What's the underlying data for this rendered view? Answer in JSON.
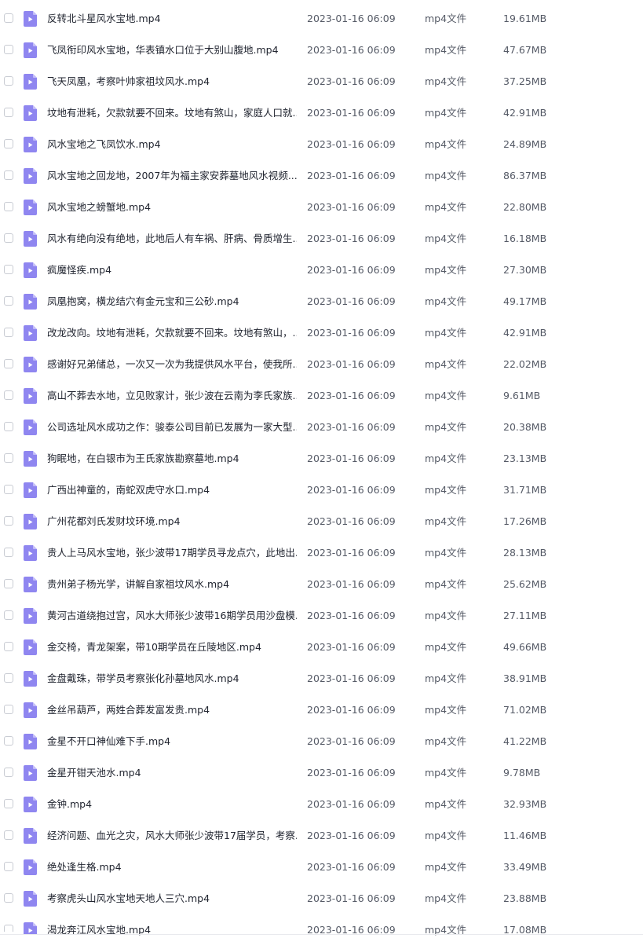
{
  "icons": {
    "file": "video-file-icon",
    "checkbox": "checkbox-unchecked",
    "icon_color": "#8f86f0",
    "icon_fold_color": "#c3bdf8"
  },
  "files": [
    {
      "name": "反转北斗星风水宝地.mp4",
      "date": "2023-01-16 06:09",
      "type": "mp4文件",
      "size": "19.61MB"
    },
    {
      "name": "飞凤衔印风水宝地，华表镇水口位于大别山腹地.mp4",
      "date": "2023-01-16 06:09",
      "type": "mp4文件",
      "size": "47.67MB"
    },
    {
      "name": "飞天凤凰，考察叶帅家祖坟风水.mp4",
      "date": "2023-01-16 06:09",
      "type": "mp4文件",
      "size": "37.25MB"
    },
    {
      "name": "坟地有泄耗，欠款就要不回来。坟地有煞山，家庭人口就...",
      "date": "2023-01-16 06:09",
      "type": "mp4文件",
      "size": "42.91MB"
    },
    {
      "name": "风水宝地之飞凤饮水.mp4",
      "date": "2023-01-16 06:09",
      "type": "mp4文件",
      "size": "24.89MB"
    },
    {
      "name": "风水宝地之回龙地，2007年为福主家安葬墓地风水视频....",
      "date": "2023-01-16 06:09",
      "type": "mp4文件",
      "size": "86.37MB"
    },
    {
      "name": "风水宝地之螃蟹地.mp4",
      "date": "2023-01-16 06:09",
      "type": "mp4文件",
      "size": "22.80MB"
    },
    {
      "name": "风水有绝向没有绝地，此地后人有车祸、肝病、骨质增生...",
      "date": "2023-01-16 06:09",
      "type": "mp4文件",
      "size": "16.18MB"
    },
    {
      "name": "疯魔怪疾.mp4",
      "date": "2023-01-16 06:09",
      "type": "mp4文件",
      "size": "27.30MB"
    },
    {
      "name": "凤凰抱窝，横龙结穴有金元宝和三公砂.mp4",
      "date": "2023-01-16 06:09",
      "type": "mp4文件",
      "size": "49.17MB"
    },
    {
      "name": "改龙改向。坟地有泄耗，欠款就要不回来。坟地有煞山，...",
      "date": "2023-01-16 06:09",
      "type": "mp4文件",
      "size": "42.91MB"
    },
    {
      "name": "感谢好兄弟储总，一次又一次为我提供风水平台，使我所...",
      "date": "2023-01-16 06:09",
      "type": "mp4文件",
      "size": "22.02MB"
    },
    {
      "name": "高山不葬去水地，立见败家计，张少波在云南为李氏家族...",
      "date": "2023-01-16 06:09",
      "type": "mp4文件",
      "size": "9.61MB"
    },
    {
      "name": "公司选址风水成功之作：骏泰公司目前已发展为一家大型...",
      "date": "2023-01-16 06:09",
      "type": "mp4文件",
      "size": "20.38MB"
    },
    {
      "name": "狗眠地，在白银市为王氏家族勘察墓地.mp4",
      "date": "2023-01-16 06:09",
      "type": "mp4文件",
      "size": "23.13MB"
    },
    {
      "name": "广西出神童的，南蛇双虎守水口.mp4",
      "date": "2023-01-16 06:09",
      "type": "mp4文件",
      "size": "31.71MB"
    },
    {
      "name": "广州花都刘氏发财坟环境.mp4",
      "date": "2023-01-16 06:09",
      "type": "mp4文件",
      "size": "17.26MB"
    },
    {
      "name": "贵人上马风水宝地，张少波带17期学员寻龙点穴，此地出...",
      "date": "2023-01-16 06:09",
      "type": "mp4文件",
      "size": "28.13MB"
    },
    {
      "name": "贵州弟子杨光学，讲解自家祖坟风水.mp4",
      "date": "2023-01-16 06:09",
      "type": "mp4文件",
      "size": "25.62MB"
    },
    {
      "name": "黄河古道绕抱过宫，风水大师张少波带16期学员用沙盘模...",
      "date": "2023-01-16 06:09",
      "type": "mp4文件",
      "size": "27.11MB"
    },
    {
      "name": "金交椅，青龙架案，带10期学员在丘陵地区.mp4",
      "date": "2023-01-16 06:09",
      "type": "mp4文件",
      "size": "49.66MB"
    },
    {
      "name": "金盘戴珠，带学员考察张化孙墓地风水.mp4",
      "date": "2023-01-16 06:09",
      "type": "mp4文件",
      "size": "38.91MB"
    },
    {
      "name": "金丝吊葫芦，两姓合葬发富发贵.mp4",
      "date": "2023-01-16 06:09",
      "type": "mp4文件",
      "size": "71.02MB"
    },
    {
      "name": "金星不开口神仙难下手.mp4",
      "date": "2023-01-16 06:09",
      "type": "mp4文件",
      "size": "41.22MB"
    },
    {
      "name": "金星开钳天池水.mp4",
      "date": "2023-01-16 06:09",
      "type": "mp4文件",
      "size": "9.78MB"
    },
    {
      "name": "金钟.mp4",
      "date": "2023-01-16 06:09",
      "type": "mp4文件",
      "size": "32.93MB"
    },
    {
      "name": "经济问题、血光之灾，风水大师张少波带17届学员，考察...",
      "date": "2023-01-16 06:09",
      "type": "mp4文件",
      "size": "11.46MB"
    },
    {
      "name": "绝处逢生格.mp4",
      "date": "2023-01-16 06:09",
      "type": "mp4文件",
      "size": "33.49MB"
    },
    {
      "name": "考察虎头山风水宝地天地人三穴.mp4",
      "date": "2023-01-16 06:09",
      "type": "mp4文件",
      "size": "23.88MB"
    },
    {
      "name": "渴龙奔江风水宝地.mp4",
      "date": "2023-01-16 06:09",
      "type": "mp4文件",
      "size": "17.08MB"
    }
  ]
}
